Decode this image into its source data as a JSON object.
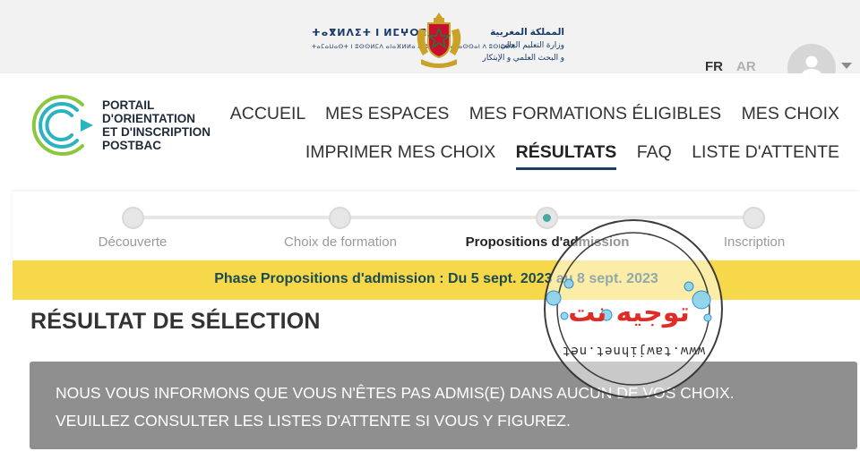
{
  "ministry": {
    "tifinagh_line1": "ⵜⴰⴳⵍⴷⵉⵜ ⵏ ⵍⵎⵖⵔⵉⴱ",
    "tifinagh_line2": "ⵜⴰⵎⴰⵡⴰⵙⵜ ⵏ ⵓⵙⵙⵍⵎⴷ ⴰⵏⴰⴼⵍⵍⴰ ⴷ ⵓⵔⵣⵣⵓ ⴰⵎⴰⵙⵙⴰⵏ ⴷ ⵓⵙⵏⵓⴱⴳ",
    "arabic_line1": "المملكة المغربية",
    "arabic_line2": "وزارة التعليم العالي",
    "arabic_line3": "و البحث العلمي و الإبتكار"
  },
  "language": {
    "fr": "FR",
    "ar": "AR"
  },
  "brand": {
    "name": "PORTAIL\nD'ORIENTATION\nET D'INSCRIPTION\nPOSTBAC"
  },
  "nav": {
    "row1": [
      "ACCUEIL",
      "MES ESPACES",
      "MES FORMATIONS ÉLIGIBLES",
      "MES CHOIX"
    ],
    "row2": [
      "IMPRIMER MES CHOIX",
      "RÉSULTATS",
      "FAQ",
      "LISTE D'ATTENTE"
    ],
    "active": "RÉSULTATS"
  },
  "steps": [
    "Découverte",
    "Choix de formation",
    "Propositions d'admission",
    "Inscription"
  ],
  "active_step": "Propositions d'admission",
  "phase_banner": "Phase Propositions d'admission : Du 5 sept. 2023 au 8 sept. 2023",
  "page_title": "RÉSULTAT DE SÉLECTION",
  "alert": {
    "line1": "NOUS VOUS INFORMONS QUE VOUS N'ÊTES PAS ADMIS(E) DANS AUCUN DE VOS CHOIX.",
    "line2": "VEUILLEZ CONSULTER LES LISTES D'ATTENTE SI VOUS Y FIGUREZ."
  },
  "watermark": {
    "arabic": "توجيه نت",
    "url": "www.tawjihnet.net"
  },
  "colors": {
    "phase_bg": "#f7d84a",
    "alert_bg": "#8f8f8f",
    "active_underline": "#1b3f5c",
    "active_step_dot": "#4aa9a3",
    "logo_teal": "#2bb3c0",
    "logo_green": "#8cc63f"
  },
  "icons": {
    "avatar": "user-icon",
    "dropdown": "chevron-down-icon"
  }
}
